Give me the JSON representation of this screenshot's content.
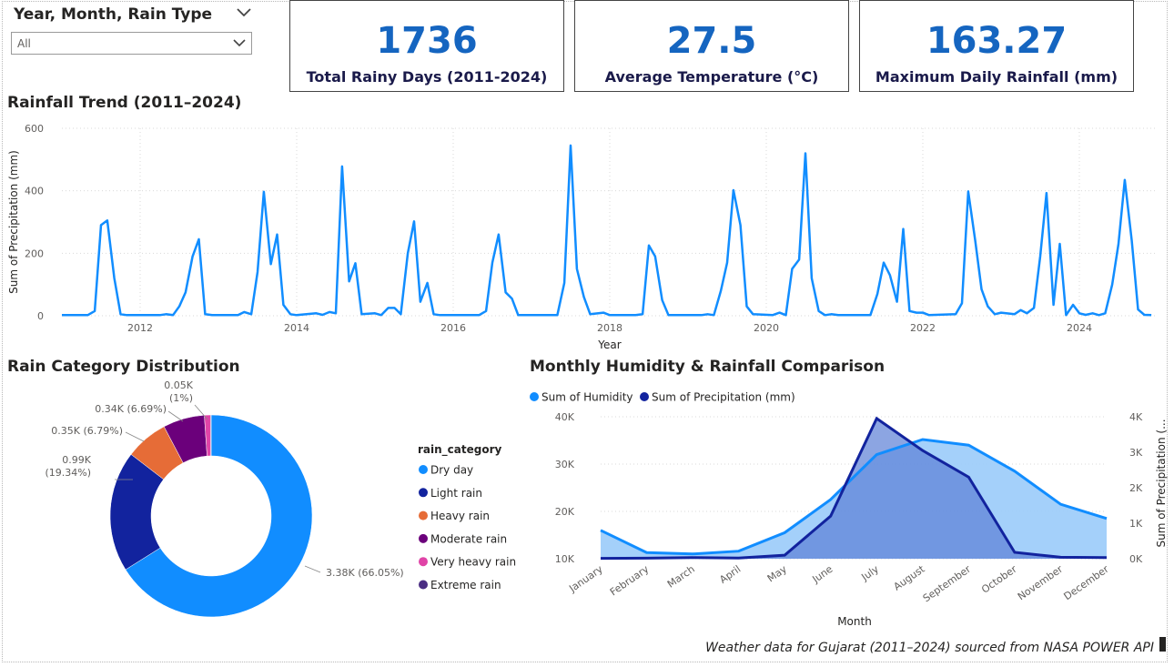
{
  "slicer": {
    "title": "Year, Month, Rain Type",
    "value": "All"
  },
  "kpis": [
    {
      "value": "1736",
      "label": "Total Rainy Days (2011-2024)"
    },
    {
      "value": "27.5",
      "label": "Average Temperature (°C)"
    },
    {
      "value": "163.27",
      "label": "Maximum Daily Rainfall (mm)"
    }
  ],
  "sections": {
    "trend": "Rainfall Trend (2011–2024)",
    "donut": "Rain Category Distribution",
    "combo": "Monthly Humidity & Rainfall Comparison"
  },
  "footnote": "Weather data for Gujarat (2011–2024) sourced from NASA POWER API",
  "colors": {
    "kpi_value": "#1565c0",
    "line": "#118dff",
    "dry_day": "#118dff",
    "light_rain": "#12239e",
    "heavy_rain": "#e66c37",
    "moderate_rain": "#6b007b",
    "very_heavy_rain": "#e044a7",
    "extreme_rain": "#4b2e83",
    "humidity_fill": "#9fcdfa",
    "precip_fill": "#5b7fd6"
  },
  "chart_data": [
    {
      "type": "line",
      "title": "Rainfall Trend (2011–2024)",
      "xlabel": "Year",
      "ylabel": "Sum of Precipitation (mm)",
      "ylim": [
        0,
        600
      ],
      "yticks": [
        0,
        200,
        400,
        600
      ],
      "xticks": [
        2012,
        2014,
        2016,
        2018,
        2020,
        2022,
        2024
      ],
      "xlim": [
        2011.0,
        2025.0
      ],
      "grid": true,
      "series": [
        {
          "values": [
            {
              "x": 2011.0,
              "y": 2
            },
            {
              "x": 2011.33,
              "y": 2
            },
            {
              "x": 2011.42,
              "y": 15
            },
            {
              "x": 2011.5,
              "y": 290
            },
            {
              "x": 2011.58,
              "y": 305
            },
            {
              "x": 2011.67,
              "y": 120
            },
            {
              "x": 2011.75,
              "y": 5
            },
            {
              "x": 2011.83,
              "y": 2
            },
            {
              "x": 2012.25,
              "y": 2
            },
            {
              "x": 2012.33,
              "y": 5
            },
            {
              "x": 2012.42,
              "y": 2
            },
            {
              "x": 2012.5,
              "y": 30
            },
            {
              "x": 2012.58,
              "y": 75
            },
            {
              "x": 2012.67,
              "y": 190
            },
            {
              "x": 2012.75,
              "y": 245
            },
            {
              "x": 2012.83,
              "y": 5
            },
            {
              "x": 2012.92,
              "y": 2
            },
            {
              "x": 2013.25,
              "y": 2
            },
            {
              "x": 2013.33,
              "y": 12
            },
            {
              "x": 2013.42,
              "y": 5
            },
            {
              "x": 2013.5,
              "y": 140
            },
            {
              "x": 2013.58,
              "y": 397
            },
            {
              "x": 2013.67,
              "y": 165
            },
            {
              "x": 2013.75,
              "y": 260
            },
            {
              "x": 2013.83,
              "y": 35
            },
            {
              "x": 2013.92,
              "y": 5
            },
            {
              "x": 2014.0,
              "y": 2
            },
            {
              "x": 2014.25,
              "y": 8
            },
            {
              "x": 2014.33,
              "y": 3
            },
            {
              "x": 2014.42,
              "y": 12
            },
            {
              "x": 2014.5,
              "y": 8
            },
            {
              "x": 2014.58,
              "y": 478
            },
            {
              "x": 2014.67,
              "y": 110
            },
            {
              "x": 2014.75,
              "y": 168
            },
            {
              "x": 2014.83,
              "y": 5
            },
            {
              "x": 2015.0,
              "y": 8
            },
            {
              "x": 2015.08,
              "y": 2
            },
            {
              "x": 2015.17,
              "y": 25
            },
            {
              "x": 2015.25,
              "y": 25
            },
            {
              "x": 2015.33,
              "y": 5
            },
            {
              "x": 2015.42,
              "y": 200
            },
            {
              "x": 2015.5,
              "y": 302
            },
            {
              "x": 2015.58,
              "y": 45
            },
            {
              "x": 2015.67,
              "y": 105
            },
            {
              "x": 2015.75,
              "y": 5
            },
            {
              "x": 2015.83,
              "y": 2
            },
            {
              "x": 2016.33,
              "y": 2
            },
            {
              "x": 2016.42,
              "y": 15
            },
            {
              "x": 2016.5,
              "y": 170
            },
            {
              "x": 2016.58,
              "y": 260
            },
            {
              "x": 2016.67,
              "y": 75
            },
            {
              "x": 2016.75,
              "y": 55
            },
            {
              "x": 2016.83,
              "y": 2
            },
            {
              "x": 2017.33,
              "y": 2
            },
            {
              "x": 2017.42,
              "y": 105
            },
            {
              "x": 2017.5,
              "y": 545
            },
            {
              "x": 2017.58,
              "y": 150
            },
            {
              "x": 2017.67,
              "y": 60
            },
            {
              "x": 2017.75,
              "y": 5
            },
            {
              "x": 2017.92,
              "y": 10
            },
            {
              "x": 2018.0,
              "y": 2
            },
            {
              "x": 2018.33,
              "y": 2
            },
            {
              "x": 2018.42,
              "y": 5
            },
            {
              "x": 2018.5,
              "y": 225
            },
            {
              "x": 2018.58,
              "y": 190
            },
            {
              "x": 2018.67,
              "y": 50
            },
            {
              "x": 2018.75,
              "y": 2
            },
            {
              "x": 2019.17,
              "y": 2
            },
            {
              "x": 2019.25,
              "y": 5
            },
            {
              "x": 2019.33,
              "y": 2
            },
            {
              "x": 2019.42,
              "y": 80
            },
            {
              "x": 2019.5,
              "y": 170
            },
            {
              "x": 2019.58,
              "y": 402
            },
            {
              "x": 2019.67,
              "y": 290
            },
            {
              "x": 2019.75,
              "y": 30
            },
            {
              "x": 2019.83,
              "y": 5
            },
            {
              "x": 2020.08,
              "y": 2
            },
            {
              "x": 2020.17,
              "y": 10
            },
            {
              "x": 2020.25,
              "y": 2
            },
            {
              "x": 2020.33,
              "y": 150
            },
            {
              "x": 2020.42,
              "y": 180
            },
            {
              "x": 2020.5,
              "y": 520
            },
            {
              "x": 2020.58,
              "y": 120
            },
            {
              "x": 2020.67,
              "y": 15
            },
            {
              "x": 2020.75,
              "y": 2
            },
            {
              "x": 2020.83,
              "y": 5
            },
            {
              "x": 2020.92,
              "y": 2
            },
            {
              "x": 2021.33,
              "y": 2
            },
            {
              "x": 2021.42,
              "y": 70
            },
            {
              "x": 2021.5,
              "y": 170
            },
            {
              "x": 2021.58,
              "y": 130
            },
            {
              "x": 2021.67,
              "y": 45
            },
            {
              "x": 2021.75,
              "y": 278
            },
            {
              "x": 2021.83,
              "y": 15
            },
            {
              "x": 2021.92,
              "y": 10
            },
            {
              "x": 2022.0,
              "y": 10
            },
            {
              "x": 2022.08,
              "y": 2
            },
            {
              "x": 2022.42,
              "y": 5
            },
            {
              "x": 2022.5,
              "y": 40
            },
            {
              "x": 2022.58,
              "y": 398
            },
            {
              "x": 2022.67,
              "y": 240
            },
            {
              "x": 2022.75,
              "y": 85
            },
            {
              "x": 2022.83,
              "y": 30
            },
            {
              "x": 2022.92,
              "y": 5
            },
            {
              "x": 2023.0,
              "y": 10
            },
            {
              "x": 2023.17,
              "y": 5
            },
            {
              "x": 2023.25,
              "y": 18
            },
            {
              "x": 2023.33,
              "y": 8
            },
            {
              "x": 2023.42,
              "y": 25
            },
            {
              "x": 2023.5,
              "y": 190
            },
            {
              "x": 2023.58,
              "y": 393
            },
            {
              "x": 2023.67,
              "y": 35
            },
            {
              "x": 2023.75,
              "y": 230
            },
            {
              "x": 2023.83,
              "y": 2
            },
            {
              "x": 2023.92,
              "y": 35
            },
            {
              "x": 2024.0,
              "y": 8
            },
            {
              "x": 2024.08,
              "y": 3
            },
            {
              "x": 2024.17,
              "y": 8
            },
            {
              "x": 2024.25,
              "y": 2
            },
            {
              "x": 2024.33,
              "y": 8
            },
            {
              "x": 2024.42,
              "y": 100
            },
            {
              "x": 2024.5,
              "y": 230
            },
            {
              "x": 2024.58,
              "y": 435
            },
            {
              "x": 2024.67,
              "y": 240
            },
            {
              "x": 2024.75,
              "y": 20
            },
            {
              "x": 2024.83,
              "y": 3
            },
            {
              "x": 2024.92,
              "y": 2
            }
          ]
        }
      ]
    },
    {
      "type": "pie",
      "title": "Rain Category Distribution",
      "legend_title": "rain_category",
      "legend_position": "right",
      "slices": [
        {
          "name": "Dry day",
          "value": 3.38,
          "label": "3.38K (66.05%)",
          "color": "#118dff"
        },
        {
          "name": "Light rain",
          "value": 0.99,
          "label": "0.99K\n(19.34%)",
          "color": "#12239e"
        },
        {
          "name": "Heavy rain",
          "value": 0.35,
          "label": "0.35K (6.79%)",
          "color": "#e66c37"
        },
        {
          "name": "Moderate rain",
          "value": 0.34,
          "label": "0.34K (6.69%)",
          "color": "#6b007b"
        },
        {
          "name": "Very heavy rain",
          "value": 0.05,
          "label": "0.05K\n(1%)",
          "color": "#e044a7"
        },
        {
          "name": "Extreme rain",
          "value": 0.005,
          "label": "",
          "color": "#4b2e83"
        }
      ]
    },
    {
      "type": "area",
      "title": "Monthly Humidity & Rainfall Comparison",
      "xlabel": "Month",
      "ylabel_right": "Sum of Precipitation (...",
      "legend_position": "top-left",
      "categories": [
        "January",
        "February",
        "March",
        "April",
        "May",
        "June",
        "July",
        "August",
        "September",
        "October",
        "November",
        "December"
      ],
      "left_axis": {
        "ylim": [
          10000,
          40000
        ],
        "ticks": [
          "10K",
          "20K",
          "30K",
          "40K"
        ]
      },
      "right_axis": {
        "ylim": [
          0,
          4000
        ],
        "ticks": [
          "0K",
          "1K",
          "2K",
          "3K",
          "4K"
        ]
      },
      "series": [
        {
          "name": "Sum of Humidity",
          "axis": "left",
          "color": "#118dff",
          "values": [
            16000,
            11300,
            11000,
            11600,
            15500,
            22500,
            32000,
            35200,
            34000,
            28500,
            21500,
            18500
          ]
        },
        {
          "name": "Sum of Precipitation (mm)",
          "axis": "right",
          "color": "#12239e",
          "values": [
            10,
            15,
            30,
            20,
            100,
            1200,
            3950,
            3050,
            2300,
            180,
            40,
            30
          ]
        }
      ]
    }
  ]
}
